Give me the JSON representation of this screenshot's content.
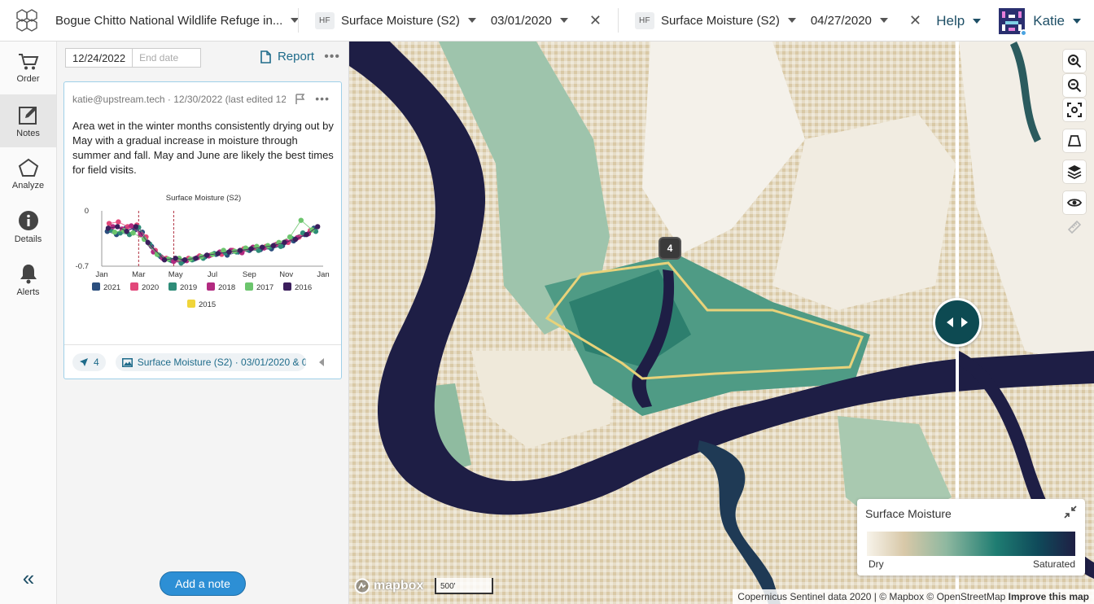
{
  "topbar": {
    "property_name": "Bogue Chitto National Wildlife Refuge in...",
    "layer_left": {
      "tag": "HF",
      "name": "Surface Moisture (S2)",
      "date": "03/01/2020"
    },
    "layer_right": {
      "tag": "HF",
      "name": "Surface Moisture (S2)",
      "date": "04/27/2020"
    },
    "help_label": "Help",
    "user_name": "Katie"
  },
  "leftnav": {
    "items": [
      {
        "label": "Order",
        "icon": "cart-icon",
        "active": false
      },
      {
        "label": "Notes",
        "icon": "edit-note-icon",
        "active": true
      },
      {
        "label": "Analyze",
        "icon": "polygon-icon",
        "active": false
      },
      {
        "label": "Details",
        "icon": "info-icon",
        "active": false
      },
      {
        "label": "Alerts",
        "icon": "bell-icon",
        "active": false
      }
    ],
    "collapse_label": "«"
  },
  "notes_panel": {
    "start_date": "12/24/2022",
    "end_date_placeholder": "End date",
    "report_label": "Report",
    "more_label": "•••",
    "note": {
      "meta": "katie@upstream.tech · 12/30/2022 (last edited 12...",
      "text": "Area wet in the winter months consistently drying out by May with a gradual increase in moisture through summer and fall. May and June are likely the best times for field visits.",
      "more_label": "•••",
      "footer_count": "4",
      "footer_layer": "Surface Moisture (S2) · 03/01/2020 & 0..."
    },
    "add_note_label": "Add a note"
  },
  "chart_data": {
    "type": "scatter",
    "title": "Surface Moisture (S2)",
    "x_ticks": [
      "Jan",
      "Mar",
      "May",
      "Jul",
      "Sep",
      "Nov",
      "Jan"
    ],
    "y_ticks": [
      "0",
      "-0.7"
    ],
    "ylim": [
      -0.7,
      0
    ],
    "markers_months": [
      2.0,
      3.9
    ],
    "series": [
      {
        "name": "2021",
        "color": "#2b4f7e",
        "values": [
          [
            0.3,
            -0.26
          ],
          [
            0.8,
            -0.3
          ],
          [
            1.3,
            -0.22
          ],
          [
            1.8,
            -0.24
          ],
          [
            2.2,
            -0.27
          ],
          [
            2.7,
            -0.45
          ],
          [
            3.2,
            -0.58
          ],
          [
            3.8,
            -0.63
          ],
          [
            4.4,
            -0.64
          ],
          [
            5.0,
            -0.61
          ],
          [
            5.6,
            -0.58
          ],
          [
            6.2,
            -0.55
          ],
          [
            6.8,
            -0.56
          ],
          [
            7.4,
            -0.52
          ],
          [
            8.0,
            -0.5
          ],
          [
            8.6,
            -0.49
          ],
          [
            9.2,
            -0.48
          ],
          [
            9.8,
            -0.44
          ],
          [
            10.4,
            -0.38
          ],
          [
            11.0,
            -0.3
          ],
          [
            11.5,
            -0.22
          ]
        ]
      },
      {
        "name": "2020",
        "color": "#e2477a",
        "values": [
          [
            0.4,
            -0.16
          ],
          [
            0.9,
            -0.14
          ],
          [
            1.4,
            -0.2
          ],
          [
            1.9,
            -0.18
          ],
          [
            2.4,
            -0.33
          ],
          [
            2.9,
            -0.5
          ],
          [
            3.5,
            -0.6
          ],
          [
            4.1,
            -0.62
          ],
          [
            4.7,
            -0.6
          ],
          [
            5.3,
            -0.57
          ],
          [
            5.9,
            -0.56
          ],
          [
            6.5,
            -0.55
          ],
          [
            7.1,
            -0.5
          ],
          [
            7.7,
            -0.48
          ],
          [
            8.3,
            -0.47
          ],
          [
            8.9,
            -0.45
          ],
          [
            9.5,
            -0.42
          ],
          [
            10.1,
            -0.4
          ],
          [
            10.7,
            -0.33
          ],
          [
            11.3,
            -0.25
          ]
        ]
      },
      {
        "name": "2019",
        "color": "#2e8c78",
        "values": [
          [
            0.5,
            -0.24
          ],
          [
            1.0,
            -0.28
          ],
          [
            1.5,
            -0.3
          ],
          [
            2.0,
            -0.21
          ],
          [
            2.6,
            -0.42
          ],
          [
            3.1,
            -0.56
          ],
          [
            3.7,
            -0.62
          ],
          [
            4.3,
            -0.66
          ],
          [
            4.9,
            -0.62
          ],
          [
            5.5,
            -0.6
          ],
          [
            6.1,
            -0.54
          ],
          [
            6.7,
            -0.53
          ],
          [
            7.3,
            -0.52
          ],
          [
            7.9,
            -0.49
          ],
          [
            8.5,
            -0.5
          ],
          [
            9.1,
            -0.46
          ],
          [
            9.7,
            -0.45
          ],
          [
            10.3,
            -0.35
          ],
          [
            10.9,
            -0.28
          ],
          [
            11.6,
            -0.26
          ]
        ]
      },
      {
        "name": "2018",
        "color": "#b22a80",
        "values": [
          [
            0.6,
            -0.2
          ],
          [
            1.1,
            -0.23
          ],
          [
            1.6,
            -0.19
          ],
          [
            2.1,
            -0.3
          ],
          [
            2.8,
            -0.52
          ],
          [
            3.3,
            -0.6
          ],
          [
            3.9,
            -0.64
          ],
          [
            4.6,
            -0.63
          ],
          [
            5.2,
            -0.59
          ],
          [
            5.8,
            -0.57
          ],
          [
            6.4,
            -0.52
          ],
          [
            7.0,
            -0.5
          ],
          [
            7.6,
            -0.53
          ],
          [
            8.2,
            -0.46
          ],
          [
            8.8,
            -0.47
          ],
          [
            9.4,
            -0.43
          ],
          [
            10.0,
            -0.39
          ],
          [
            10.6,
            -0.34
          ],
          [
            11.2,
            -0.29
          ]
        ]
      },
      {
        "name": "2017",
        "color": "#6cc56d",
        "values": [
          [
            0.7,
            -0.27
          ],
          [
            1.2,
            -0.25
          ],
          [
            1.7,
            -0.28
          ],
          [
            2.3,
            -0.36
          ],
          [
            3.0,
            -0.55
          ],
          [
            3.6,
            -0.61
          ],
          [
            4.2,
            -0.6
          ],
          [
            4.8,
            -0.61
          ],
          [
            5.4,
            -0.58
          ],
          [
            6.0,
            -0.55
          ],
          [
            6.6,
            -0.5
          ],
          [
            7.2,
            -0.51
          ],
          [
            7.8,
            -0.47
          ],
          [
            8.4,
            -0.45
          ],
          [
            9.0,
            -0.44
          ],
          [
            9.6,
            -0.4
          ],
          [
            10.2,
            -0.33
          ],
          [
            10.8,
            -0.12
          ],
          [
            11.4,
            -0.24
          ]
        ]
      },
      {
        "name": "2016",
        "color": "#3b1e5c",
        "values": [
          [
            0.35,
            -0.22
          ],
          [
            0.85,
            -0.2
          ],
          [
            1.35,
            -0.26
          ],
          [
            1.85,
            -0.2
          ],
          [
            2.5,
            -0.4
          ],
          [
            3.4,
            -0.62
          ],
          [
            4.0,
            -0.6
          ],
          [
            4.5,
            -0.62
          ],
          [
            5.1,
            -0.6
          ],
          [
            5.7,
            -0.56
          ],
          [
            6.3,
            -0.54
          ],
          [
            6.9,
            -0.52
          ],
          [
            7.5,
            -0.5
          ],
          [
            8.1,
            -0.48
          ],
          [
            8.7,
            -0.46
          ],
          [
            9.3,
            -0.44
          ],
          [
            9.9,
            -0.4
          ],
          [
            10.5,
            -0.36
          ],
          [
            11.1,
            -0.3
          ],
          [
            11.7,
            -0.2
          ]
        ]
      },
      {
        "name": "2015",
        "color": "#f0d53a",
        "values": []
      }
    ]
  },
  "map": {
    "marker_label": "4",
    "legend": {
      "title": "Surface Moisture",
      "min_label": "Dry",
      "max_label": "Saturated"
    },
    "logo_text": "mapbox",
    "scale_label": "500'",
    "attribution_text": "Copernicus Sentinel data 2020 | © Mapbox © OpenStreetMap",
    "attribution_link": "Improve this map"
  }
}
